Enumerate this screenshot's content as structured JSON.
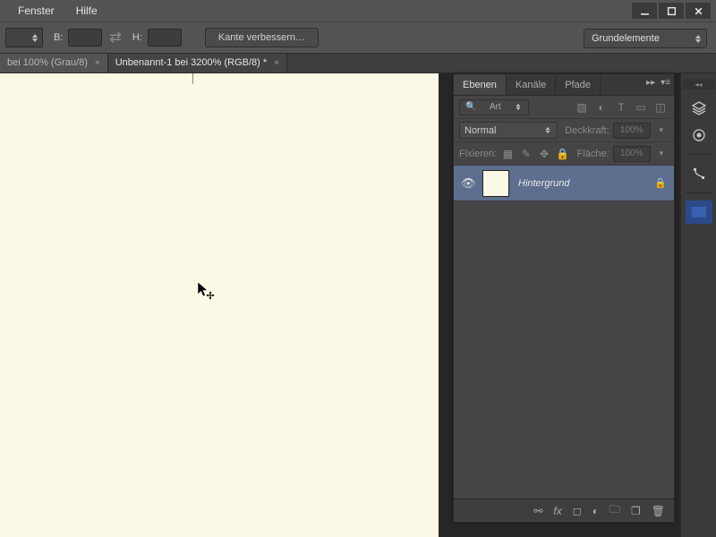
{
  "menu": {
    "fenster": "Fenster",
    "hilfe": "Hilfe"
  },
  "options": {
    "b_label": "B:",
    "h_label": "H:",
    "refine_edge": "Kante verbessern…",
    "workspace_selector": "Grundelemente"
  },
  "tabs": {
    "inactive": "bei 100% (Grau/8)",
    "active": "Unbenannt-1 bei 3200% (RGB/8) *"
  },
  "panel": {
    "tab_layers": "Ebenen",
    "tab_channels": "Kanäle",
    "tab_paths": "Pfade",
    "filter_label": "Art",
    "blend_mode": "Normal",
    "opacity_label": "Deckkraft:",
    "opacity_value": "100%",
    "lock_label": "Fixieren:",
    "fill_label": "Fläche:",
    "fill_value": "100%",
    "layer_name": "Hintergrund"
  }
}
